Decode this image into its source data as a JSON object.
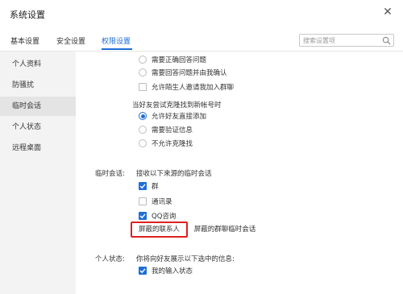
{
  "window": {
    "title": "系统设置",
    "close_glyph": "✕"
  },
  "tabs": [
    {
      "label": "基本设置",
      "active": false
    },
    {
      "label": "安全设置",
      "active": false
    },
    {
      "label": "权限设置",
      "active": true
    }
  ],
  "search": {
    "placeholder": "搜索设置项",
    "value": ""
  },
  "sidebar": {
    "items": [
      {
        "label": "个人资料",
        "active": false
      },
      {
        "label": "防骚扰",
        "active": false
      },
      {
        "label": "临时会话",
        "active": true
      },
      {
        "label": "个人状态",
        "active": false
      },
      {
        "label": "远程桌面",
        "active": false
      }
    ]
  },
  "verify_options": [
    {
      "label": "需要正确回答问题",
      "checked": false,
      "control": "radio"
    },
    {
      "label": "需要回答问题并由我确认",
      "checked": false,
      "control": "radio"
    },
    {
      "label": "允许陌生人邀请我加入群聊",
      "checked": false,
      "control": "checkbox"
    }
  ],
  "find_new_account": {
    "heading": "当好友尝试克隆找到新帐号时",
    "options": [
      {
        "label": "允许好友直接添加",
        "checked": true
      },
      {
        "label": "需要验证信息",
        "checked": false
      },
      {
        "label": "不允许克隆找",
        "checked": false
      }
    ]
  },
  "temp_session": {
    "section_label": "临时会话:",
    "description": "接收以下来源的临时会话",
    "options": [
      {
        "label": "群",
        "checked": true
      },
      {
        "label": "通讯录",
        "checked": false
      },
      {
        "label": "QQ咨询",
        "checked": true
      }
    ],
    "buttons": {
      "blocked_contacts": "屏蔽的联系人",
      "blocked_group_chats": "屏蔽的群聊临时会话"
    }
  },
  "personal_status": {
    "section_label": "个人状态:",
    "description": "你将向好友展示以下选中的信息:",
    "options": [
      {
        "label": "我的输入状态",
        "checked": true
      }
    ]
  },
  "colors": {
    "accent": "#1e6fd9",
    "highlight_border": "#e02020",
    "sidebar_bg": "#f3f3f3"
  }
}
